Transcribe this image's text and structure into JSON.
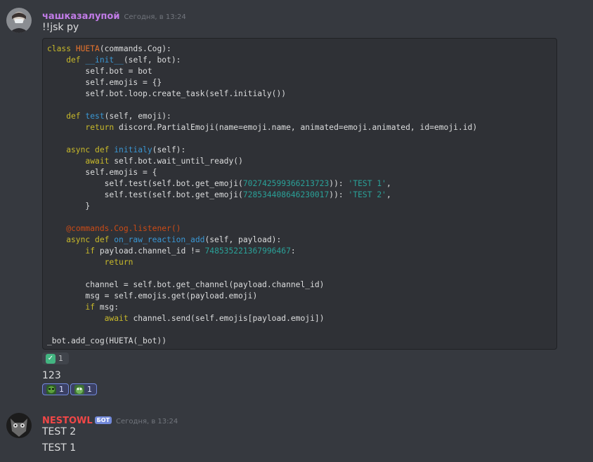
{
  "message1": {
    "username": "чашказалупой",
    "username_color": "#c27ce8",
    "timestamp": "Сегодня, в 13:24",
    "content": "!!jsk py",
    "code_lines": [
      [
        [
          "class ",
          "kw"
        ],
        [
          "HUETA",
          "cls"
        ],
        [
          "(commands.Cog):",
          ""
        ]
      ],
      [
        [
          "    def ",
          "kw"
        ],
        [
          "__init__",
          "fn"
        ],
        [
          "(self, bot):",
          ""
        ]
      ],
      [
        [
          "        self.bot = bot",
          ""
        ]
      ],
      [
        [
          "        self.emojis = {}",
          ""
        ]
      ],
      [
        [
          "        self.bot.loop.create_task(self.initialy())",
          ""
        ]
      ],
      [
        [
          "",
          ""
        ]
      ],
      [
        [
          "    def ",
          "kw"
        ],
        [
          "test",
          "fn"
        ],
        [
          "(self, emoji):",
          ""
        ]
      ],
      [
        [
          "        ",
          ""
        ],
        [
          "return",
          "kw"
        ],
        [
          " discord.PartialEmoji(name=emoji.name, animated=emoji.animated, id=emoji.id)",
          ""
        ]
      ],
      [
        [
          "",
          ""
        ]
      ],
      [
        [
          "    async def ",
          "kw"
        ],
        [
          "initialy",
          "fn"
        ],
        [
          "(self):",
          ""
        ]
      ],
      [
        [
          "        ",
          ""
        ],
        [
          "await",
          "kw"
        ],
        [
          " self.bot.wait_until_ready()",
          ""
        ]
      ],
      [
        [
          "        self.emojis = {",
          ""
        ]
      ],
      [
        [
          "            self.test(self.bot.get_emoji(",
          ""
        ],
        [
          "702742599366213723",
          "num"
        ],
        [
          ")): ",
          ""
        ],
        [
          "'TEST 1'",
          "str"
        ],
        [
          ",",
          ""
        ]
      ],
      [
        [
          "            self.test(self.bot.get_emoji(",
          ""
        ],
        [
          "728534408646230017",
          "num"
        ],
        [
          ")): ",
          ""
        ],
        [
          "'TEST 2'",
          "str"
        ],
        [
          ",",
          ""
        ]
      ],
      [
        [
          "        }",
          ""
        ]
      ],
      [
        [
          "",
          ""
        ]
      ],
      [
        [
          "    ",
          ""
        ],
        [
          "@commands.Cog.listener()",
          "dec"
        ]
      ],
      [
        [
          "    async def ",
          "kw"
        ],
        [
          "on_raw_reaction_add",
          "fn"
        ],
        [
          "(self, payload):",
          ""
        ]
      ],
      [
        [
          "        ",
          ""
        ],
        [
          "if",
          "kw"
        ],
        [
          " payload.channel_id != ",
          ""
        ],
        [
          "748535221367996467",
          "num"
        ],
        [
          ":",
          ""
        ]
      ],
      [
        [
          "            ",
          ""
        ],
        [
          "return",
          "kw"
        ]
      ],
      [
        [
          "",
          ""
        ]
      ],
      [
        [
          "        channel = self.bot.get_channel(payload.channel_id)",
          ""
        ]
      ],
      [
        [
          "        msg = self.emojis.get(payload.emoji)",
          ""
        ]
      ],
      [
        [
          "        ",
          ""
        ],
        [
          "if",
          "kw"
        ],
        [
          " msg:",
          ""
        ]
      ],
      [
        [
          "            ",
          ""
        ],
        [
          "await",
          "kw"
        ],
        [
          " channel.send(self.emojis[payload.emoji])",
          ""
        ]
      ],
      [
        [
          "",
          ""
        ]
      ],
      [
        [
          "_bot.add_cog(HUETA(_bot))",
          ""
        ]
      ]
    ],
    "reaction_check": {
      "emoji": "✅",
      "count": "1"
    },
    "content2": "123",
    "reactions2": [
      {
        "emoji": "frog-icon",
        "count": "1"
      },
      {
        "emoji": "pepe-icon",
        "count": "1"
      }
    ]
  },
  "message2": {
    "username": "NESTOWL",
    "username_color": "#f04747",
    "bot_tag": "БОТ",
    "timestamp": "Сегодня, в 13:24",
    "lines": [
      "TEST 2",
      "TEST 1"
    ]
  }
}
